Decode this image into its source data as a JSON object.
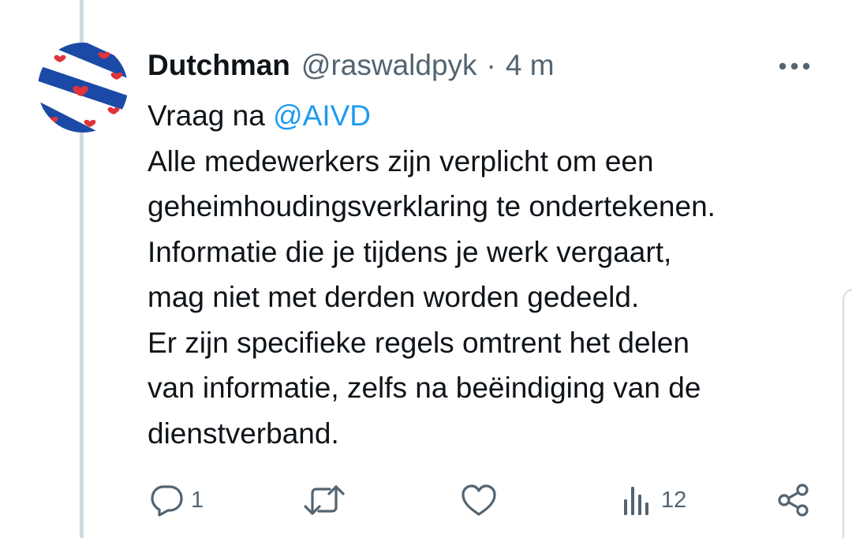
{
  "tweet": {
    "display_name": "Dutchman",
    "handle": "@raswaldpyk",
    "separator": "·",
    "time": "4 m",
    "text_lines": [
      {
        "prefix": "Vraag na ",
        "mention": "@AIVD"
      },
      {
        "text": "Alle medewerkers zijn verplicht om een"
      },
      {
        "text": "geheimhoudingsverklaring te ondertekenen."
      },
      {
        "text": "Informatie die je tijdens je werk vergaart,"
      },
      {
        "text": "mag niet met derden worden gedeeld."
      },
      {
        "text": "Er zijn specifieke regels omtrent het delen"
      },
      {
        "text": "van informatie, zelfs na beëindiging van de"
      },
      {
        "text": "dienstverband."
      }
    ]
  },
  "actions": {
    "reply_count": "1",
    "repost_count": "",
    "like_count": "",
    "views_count": "12"
  },
  "icons": {
    "avatar": "frisian-flag-avatar",
    "more": "more-dots-icon",
    "reply": "reply-bubble-icon",
    "repost": "repost-icon",
    "like": "heart-icon",
    "views": "views-bar-chart-icon",
    "share": "share-icon"
  },
  "colors": {
    "text": "#0f1419",
    "secondary": "#536471",
    "mention": "#1d9bf0",
    "thread_line": "#cfd9de",
    "flag_blue": "#1b4aa6",
    "flag_red": "#e0333a"
  }
}
